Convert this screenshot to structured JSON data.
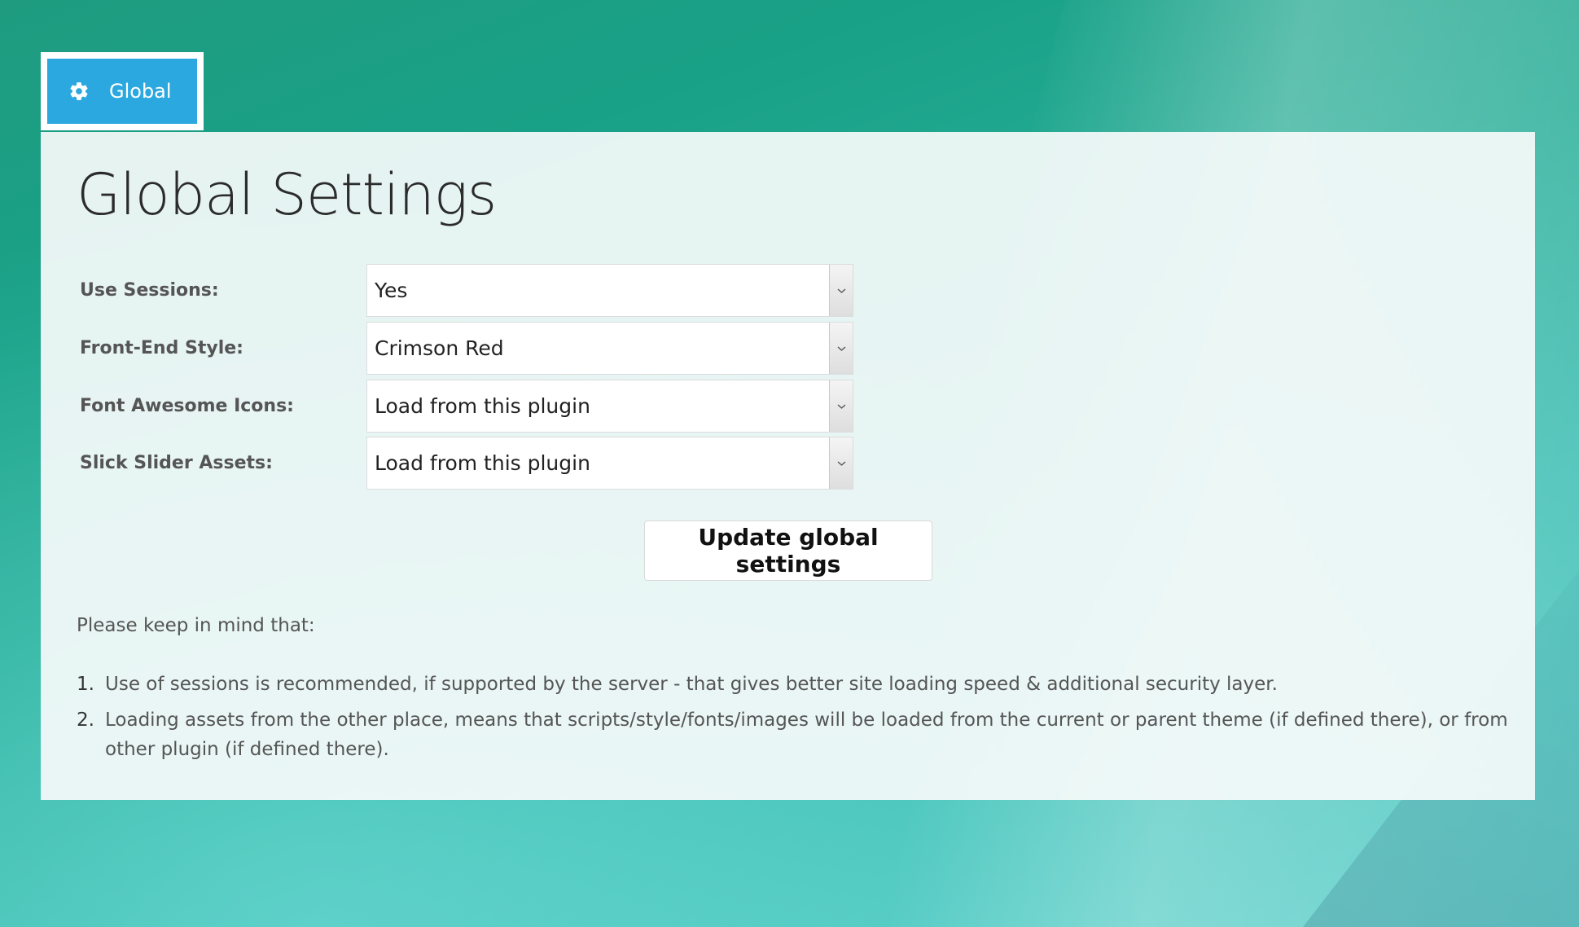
{
  "tabs": [
    {
      "label": "Global",
      "icon": "gear-icon",
      "active": true
    }
  ],
  "page": {
    "title": "Global Settings"
  },
  "settings": [
    {
      "label": "Use Sessions:",
      "value": "Yes"
    },
    {
      "label": "Front-End Style:",
      "value": "Crimson Red"
    },
    {
      "label": "Font Awesome Icons:",
      "value": "Load from this plugin"
    },
    {
      "label": "Slick Slider Assets:",
      "value": "Load from this plugin"
    }
  ],
  "actions": {
    "update_label": "Update global settings"
  },
  "notes": {
    "intro": "Please keep in mind that:",
    "items": [
      {
        "num": "1.",
        "text": "Use of sessions is recommended, if supported by the server - that gives better site loading speed & additional security layer."
      },
      {
        "num": "2.",
        "text": "Loading assets from the other place, means that scripts/style/fonts/images will be loaded from the current or parent theme (if defined there), or from other plugin (if defined there)."
      }
    ]
  },
  "colors": {
    "tab_active": "#2ba8e0",
    "background_teal": "#19a187",
    "panel": "#f5fafa"
  }
}
